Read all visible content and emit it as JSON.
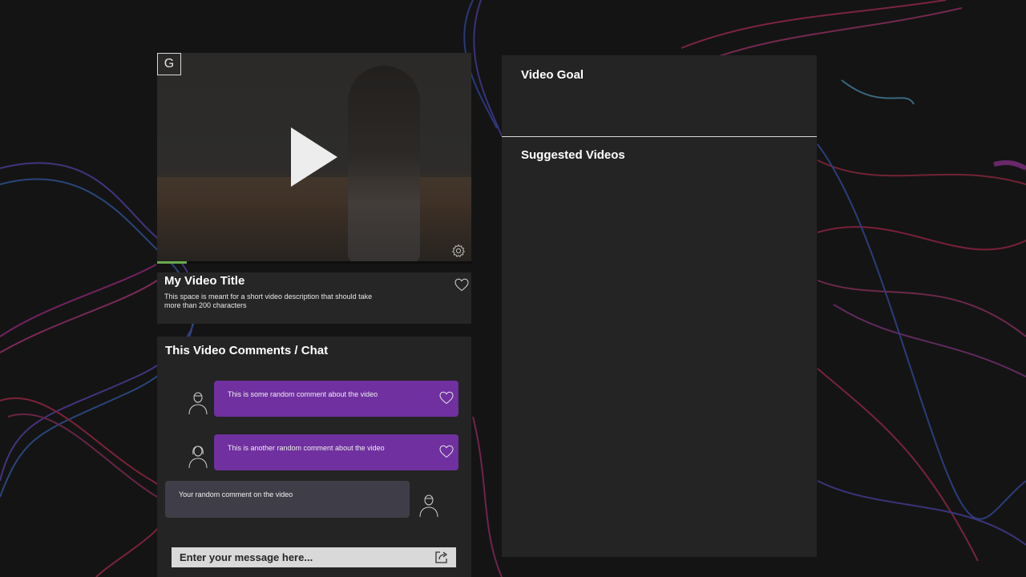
{
  "player": {
    "logo_letter": "G",
    "progress": 0.095,
    "accent_color": "#6aa84f"
  },
  "video": {
    "title": "My Video Title",
    "description": "This space is meant for a short video description that should take more than 200 characters"
  },
  "comments": {
    "title": "This Video Comments / Chat",
    "items": [
      {
        "text": "This is some random comment about the video"
      },
      {
        "text": "This is another random comment about the video"
      }
    ],
    "own_comment": "Your random comment on the video",
    "input_placeholder": "Enter your message here...",
    "bubble_color": "#7030a0"
  },
  "sidebar": {
    "goal_title": "Video Goal",
    "suggested_title": "Suggested Videos"
  },
  "icons": [
    "play-icon",
    "gear-icon",
    "heart-icon",
    "person-icon",
    "share-icon"
  ]
}
